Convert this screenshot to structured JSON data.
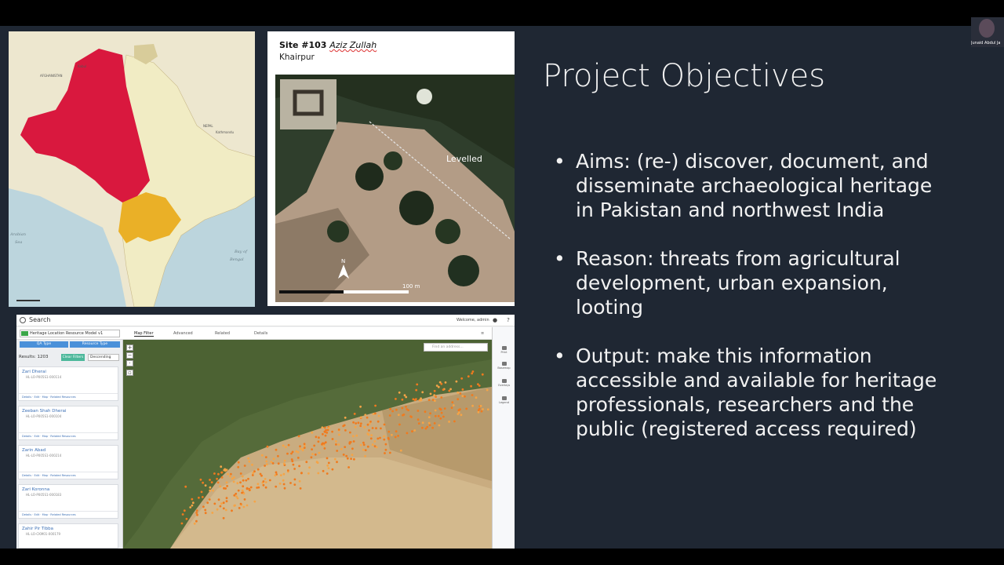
{
  "webcam": {
    "name": "Junaid Abdul Ja"
  },
  "site_panel": {
    "title_prefix": "Site #103 ",
    "title_name": "Aziz Zullah",
    "subtitle": "Khairpur",
    "label": "Levelled",
    "scale_label": "100 m"
  },
  "app": {
    "search": "Search",
    "welcome": "Welcome, admin",
    "model": "Heritage Location Resource Model v1",
    "tabs": [
      "Map Filter",
      "Advanced",
      "Related",
      "Details"
    ],
    "filters": [
      "QA Type",
      "Resource Type"
    ],
    "results_count": "Results: 1203",
    "clear_filters": "Clear Filters",
    "sort": "Descending",
    "map_search_placeholder": "Find an address...",
    "rightbar": [
      "Print",
      "Basemap",
      "Overlays",
      "Legend"
    ],
    "results": [
      {
        "name": "Zari Dherai",
        "id": "HL-LO-P005S1-000114",
        "foot": "Details · Edit · Map · Related Resources"
      },
      {
        "name": "Zeeban Shah Dherai",
        "id": "HL-LO-P005S1-000104",
        "foot": "Details · Edit · Map · Related Resources"
      },
      {
        "name": "Zarin Abad",
        "id": "HL-LO-P005S1-000214",
        "foot": "Details · Edit · Map · Related Resources"
      },
      {
        "name": "Zari Koronna",
        "id": "HL-LO-P005S1-000183",
        "foot": "Details · Edit · Map · Related Resources"
      },
      {
        "name": "Zahir Pir Tibba",
        "id": "HL-LO-CKM01-000179",
        "foot": "Details · Edit · Map · Related Resources"
      }
    ]
  },
  "slide": {
    "title": "Project Objectives",
    "bullets": [
      {
        "lines": [
          "Aims: (re-) discover, document, and",
          "disseminate archaeological heritage",
          "in Pakistan and northwest India"
        ]
      },
      {
        "lines": [
          "Reason: threats from agricultural",
          "development, urban expansion,",
          "looting"
        ]
      },
      {
        "lines": [
          "Output: make this information",
          "accessible and available for heritage",
          "professionals, researchers and the",
          "public (registered access required)"
        ]
      }
    ]
  },
  "colors": {
    "slide_bg": "#1f2733",
    "pakistan": "#d9183e",
    "northwest_india": "#eab027",
    "map_land": "#f1ecc4",
    "accent_blue": "#4a90d9"
  }
}
